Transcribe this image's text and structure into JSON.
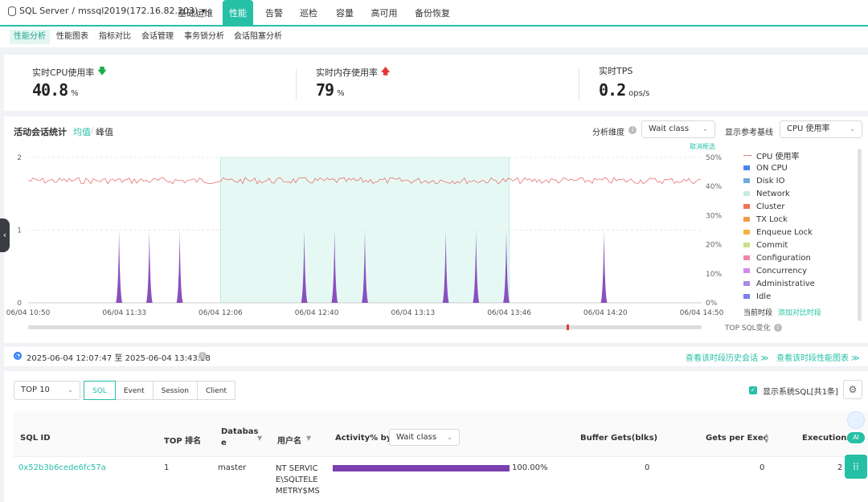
{
  "header": {
    "db_label": "SQL Server",
    "instance": "mssql2019(172.16.82.203)",
    "tabs": [
      "基础运维",
      "性能",
      "告警",
      "巡检",
      "容量",
      "高可用",
      "备份恢复"
    ]
  },
  "subnav": [
    "性能分析",
    "性能图表",
    "指标对比",
    "会话管理",
    "事务锁分析",
    "会话阻塞分析"
  ],
  "metrics": [
    {
      "label": "实时CPU使用率",
      "value": "40.8",
      "unit": "%",
      "trend": "down"
    },
    {
      "label": "实时内存使用率",
      "value": "79",
      "unit": "%",
      "trend": "up"
    },
    {
      "label": "实时TPS",
      "value": "0.2",
      "unit": "ops/s"
    }
  ],
  "chart_panel": {
    "title": "活动会话统计",
    "mode_avg": "均值",
    "mode_sep": "/",
    "mode_peak": "峰值",
    "dim_label": "分析维度",
    "dim_value": "Wait class",
    "ref_label": "显示参考基线",
    "ref_value": "CPU 使用率",
    "cancel_select": "取消框选",
    "current_period": "当前时段",
    "add_compare": "添加对比时段",
    "top_sql_change": "TOP SQL变化"
  },
  "chart_data": {
    "type": "area",
    "y_left_ticks": [
      "0",
      "1",
      "2"
    ],
    "y_right_ticks": [
      "0%",
      "10%",
      "20%",
      "30%",
      "40%",
      "50%"
    ],
    "x_ticks": [
      "06/04 10:50",
      "06/04 11:33",
      "06/04 12:06",
      "06/04 12:40",
      "06/04 13:13",
      "06/04 13:46",
      "06/04 14:20",
      "06/04 14:50"
    ],
    "ylim": [
      0,
      2
    ],
    "selection": [
      "06/04 12:06",
      "06/04 13:46"
    ],
    "cpu_baseline_percent": 42,
    "spikes": [
      {
        "x_frac": 0.135,
        "value": 1
      },
      {
        "x_frac": 0.18,
        "value": 1
      },
      {
        "x_frac": 0.225,
        "value": 1
      },
      {
        "x_frac": 0.41,
        "value": 1
      },
      {
        "x_frac": 0.455,
        "value": 1
      },
      {
        "x_frac": 0.5,
        "value": 1
      },
      {
        "x_frac": 0.62,
        "value": 1
      },
      {
        "x_frac": 0.665,
        "value": 1
      },
      {
        "x_frac": 0.71,
        "value": 1
      },
      {
        "x_frac": 0.855,
        "value": 1
      }
    ],
    "legend": [
      {
        "name": "CPU 使用率",
        "color": "#e57373",
        "style": "dashed"
      },
      {
        "name": "ON CPU",
        "color": "#4c83f5"
      },
      {
        "name": "Disk IO",
        "color": "#6fa8dc"
      },
      {
        "name": "Network",
        "color": "#c6ebe3"
      },
      {
        "name": "Cluster",
        "color": "#f07159"
      },
      {
        "name": "TX Lock",
        "color": "#ef9a4c"
      },
      {
        "name": "Enqueue Lock",
        "color": "#f0b43c"
      },
      {
        "name": "Commit",
        "color": "#c9df8a"
      },
      {
        "name": "Configuration",
        "color": "#f086a6"
      },
      {
        "name": "Concurrency",
        "color": "#d08be8"
      },
      {
        "name": "Administrative",
        "color": "#a98be6"
      },
      {
        "name": "Idle",
        "color": "#7b7ef0"
      }
    ],
    "series_color": "#8a4fbf"
  },
  "timebar": {
    "start": "2025-06-04 12:07:47",
    "to": "至",
    "end": "2025-06-04 13:43:28",
    "link_history": "查看该时段历史会话 ≫",
    "link_chart": "查看该时段性能图表 ≫"
  },
  "table_panel": {
    "top_select": "TOP 10",
    "segments": [
      "SQL",
      "Event",
      "Session",
      "Client"
    ],
    "show_sys_sql": "显示系统SQL[共1条]",
    "columns": {
      "sql_id": "SQL ID",
      "rank": "TOP 排名",
      "db_1": "Databas",
      "db_2": "e",
      "user": "用户名",
      "activity": "Activity% by",
      "activity_select": "Wait class",
      "buffer": "Buffer Gets(blks)",
      "gets": "Gets per Exec",
      "exec": "Executions"
    },
    "rows": [
      {
        "sql_id": "0x52b3b6cede6fc57a",
        "rank": "1",
        "db": "master",
        "user_1": "NT SERVIC",
        "user_2": "E\\SQLTELE",
        "user_3": "METRY$MS",
        "activity": "100.00%",
        "activity_frac": 1.0,
        "buffer": "0",
        "gets": "0",
        "exec": "2"
      }
    ]
  },
  "colors": {
    "accent": "#25c0a6",
    "up_arrow": "#e53935",
    "down_arrow": "#1aae4a"
  }
}
